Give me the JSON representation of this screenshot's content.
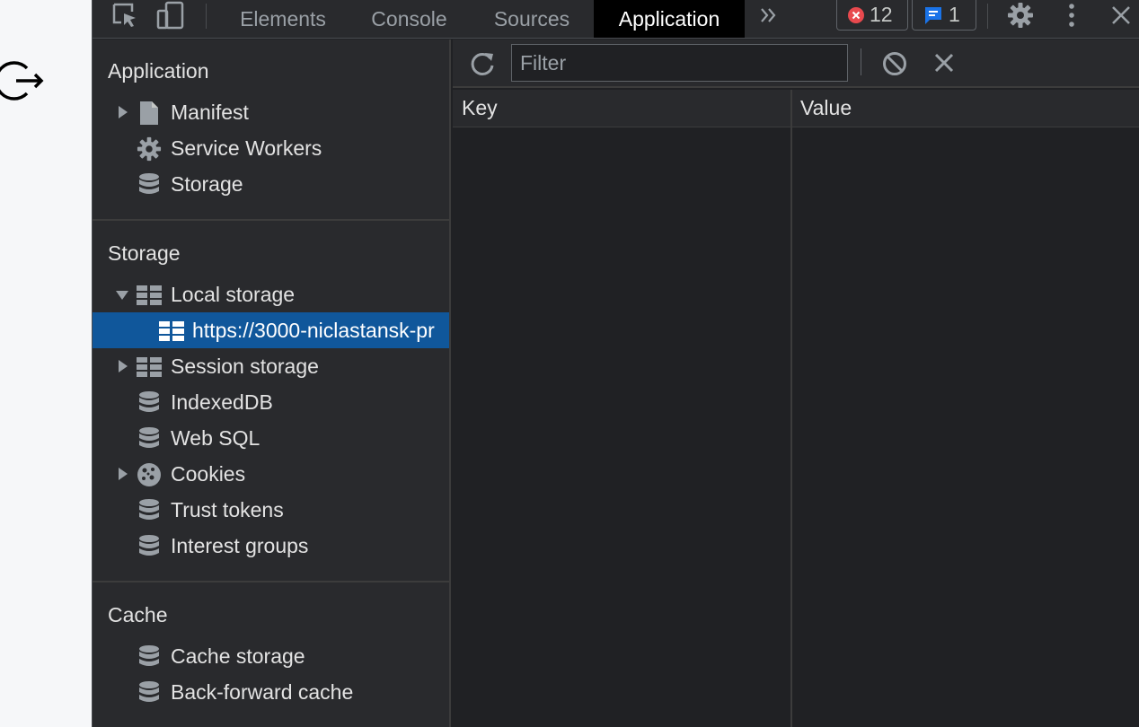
{
  "toolbar": {
    "tabs": [
      "Elements",
      "Console",
      "Sources",
      "Application"
    ],
    "active_tab": "Application",
    "error_count": "12",
    "message_count": "1"
  },
  "sidebar": {
    "application": {
      "title": "Application",
      "items": [
        {
          "label": "Manifest",
          "icon": "file-icon"
        },
        {
          "label": "Service Workers",
          "icon": "gear-icon"
        },
        {
          "label": "Storage",
          "icon": "database-icon"
        }
      ]
    },
    "storage": {
      "title": "Storage",
      "items": [
        {
          "label": "Local storage",
          "icon": "table-icon",
          "expanded": true
        },
        {
          "label": "https://3000-niclastansk-pr",
          "icon": "table-icon",
          "selected": true
        },
        {
          "label": "Session storage",
          "icon": "table-icon"
        },
        {
          "label": "IndexedDB",
          "icon": "database-icon"
        },
        {
          "label": "Web SQL",
          "icon": "database-icon"
        },
        {
          "label": "Cookies",
          "icon": "cookie-icon"
        },
        {
          "label": "Trust tokens",
          "icon": "database-icon"
        },
        {
          "label": "Interest groups",
          "icon": "database-icon"
        }
      ]
    },
    "cache": {
      "title": "Cache",
      "items": [
        {
          "label": "Cache storage",
          "icon": "database-icon"
        },
        {
          "label": "Back-forward cache",
          "icon": "database-icon"
        }
      ]
    }
  },
  "main": {
    "filter_placeholder": "Filter",
    "columns": [
      "Key",
      "Value"
    ]
  },
  "colors": {
    "selected": "#10579b",
    "error": "#e8494e",
    "message": "#1a73e8"
  }
}
